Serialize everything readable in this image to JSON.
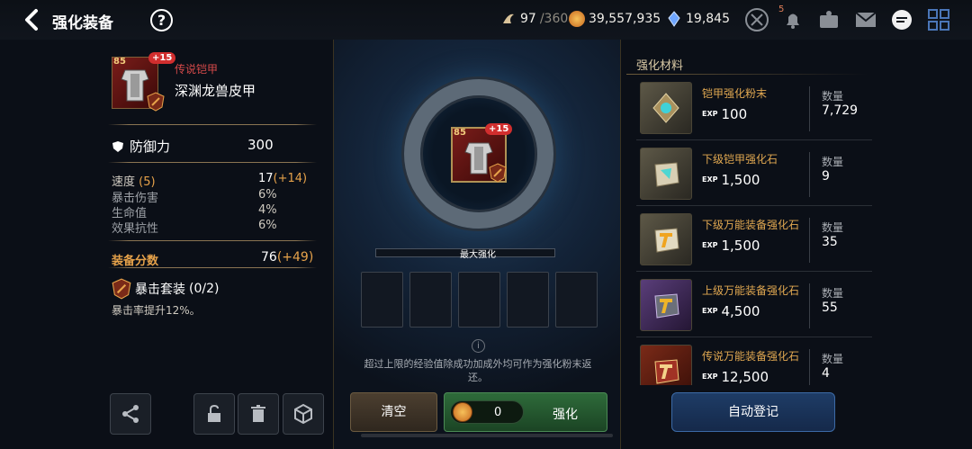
{
  "header": {
    "title": "强化装备",
    "help": "?",
    "stamina": {
      "value": "97",
      "cap": "/360"
    },
    "gold": "39,557,935",
    "crystals": "19,845",
    "notification_count": "5"
  },
  "item": {
    "level": "85",
    "plus": "+15",
    "rarity": "传说铠甲",
    "name": "深渊龙兽皮甲",
    "main_stat": {
      "label": "防御力",
      "value": "300"
    },
    "substats": [
      {
        "name": "速度",
        "count": "(5)",
        "value": "17",
        "gain": "(+14)"
      },
      {
        "name": "暴击伤害",
        "value": "6%"
      },
      {
        "name": "生命值",
        "value": "4%"
      },
      {
        "name": "效果抗性",
        "value": "6%"
      }
    ],
    "score": {
      "label": "装备分数",
      "value": "76",
      "gain": "(+49)"
    },
    "set": {
      "name": "暴击套装",
      "count": "(0/2)",
      "desc": "暴击率提升12%。"
    }
  },
  "center": {
    "max_label": "最大强化",
    "info": "超过上限的经验值除成功加成外均可作为强化粉末返还。",
    "clear_label": "清空",
    "cost": "0",
    "enhance_label": "强化"
  },
  "materials": {
    "title": "强化材料",
    "qty_label": "数量",
    "exp_tag": "EXP",
    "items": [
      {
        "name": "铠甲强化粉末",
        "exp": "100",
        "qty": "7,729",
        "color": "#3fd1d8"
      },
      {
        "name": "下级铠甲强化石",
        "exp": "1,500",
        "qty": "9",
        "color": "#4ed6d2"
      },
      {
        "name": "下级万能装备强化石",
        "exp": "1,500",
        "qty": "35",
        "color": "#f0a41f"
      },
      {
        "name": "上级万能装备强化石",
        "exp": "4,500",
        "qty": "55",
        "color": "#f0b428"
      },
      {
        "name": "传说万能装备强化石",
        "exp": "12,500",
        "qty": "4",
        "color": "#e4422b"
      }
    ],
    "auto_label": "自动登记"
  },
  "colors": {
    "accent_gold": "#e6a24a",
    "rarity_red": "#d74a4a",
    "enhance_green": "#2e6b3a"
  }
}
